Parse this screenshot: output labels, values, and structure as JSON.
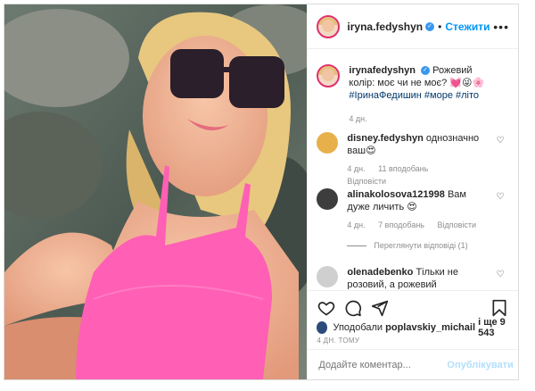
{
  "post": {
    "author": "iryna.fedyshyn",
    "follow_label": "Стежити",
    "separator": "•",
    "caption": {
      "username": "irynafedyshyn",
      "text": "Рожевий колір: моє чи не моє? 💓😜🌸",
      "hashtags": "#ІринаФедишин #море #літо",
      "time": "4 дн."
    },
    "comments": [
      {
        "username": "disney.fedyshyn",
        "text": "однозначно ваш😍",
        "time": "4 дн.",
        "likes": "11 вподобань",
        "reply": "Відповісти"
      },
      {
        "username": "alinakolosova121998",
        "text": "Вам дуже личить 😍",
        "time": "4 дн.",
        "likes": "7 вподобань",
        "reply": "Відповісти",
        "view_replies": "Переглянути відповіді (1)"
      },
      {
        "username": "olenadebenko",
        "text": "Тільки не розовий, а рожевий"
      }
    ],
    "liked_by_prefix": "Уподобали",
    "liked_by_user": "poplavskiy_michail",
    "liked_by_suffix": "і ще 9 543",
    "posted_ago": "4 ДН. ТОМУ",
    "comment_placeholder": "Додайте коментар...",
    "publish_label": "Опублікувати"
  },
  "icons": [
    "more-icon",
    "heart-icon",
    "comment-icon",
    "share-icon",
    "bookmark-icon",
    "verified-icon"
  ],
  "colors": {
    "accent": "#0095f6",
    "publish_disabled": "#b2dffc",
    "swimsuit": "#ff5fb4"
  }
}
